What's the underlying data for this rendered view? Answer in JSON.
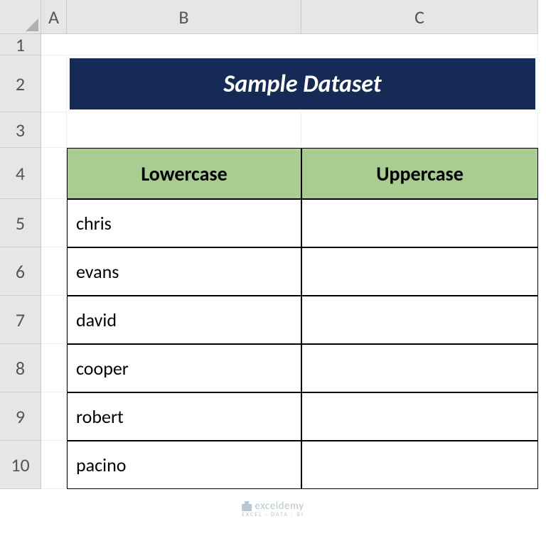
{
  "columns": {
    "A": "A",
    "B": "B",
    "C": "C"
  },
  "rows": {
    "r1": "1",
    "r2": "2",
    "r3": "3",
    "r4": "4",
    "r5": "5",
    "r6": "6",
    "r7": "7",
    "r8": "8",
    "r9": "9",
    "r10": "10"
  },
  "title": "Sample Dataset",
  "headers": {
    "lowercase": "Lowercase",
    "uppercase": "Uppercase"
  },
  "data": {
    "lowercase": [
      "chris",
      "evans",
      "david",
      "cooper",
      "robert",
      "pacino"
    ],
    "uppercase": [
      "",
      "",
      "",
      "",
      "",
      ""
    ]
  },
  "watermark": {
    "brand": "exceldemy",
    "tagline": "EXCEL · DATA · BI"
  }
}
